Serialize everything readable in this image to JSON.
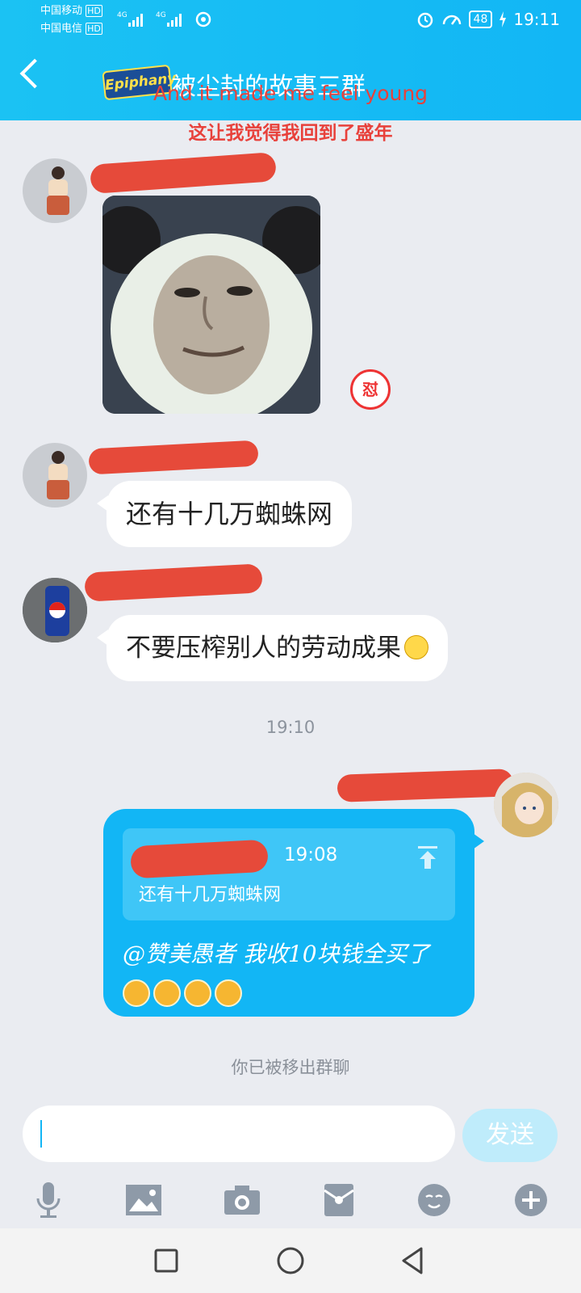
{
  "status_bar": {
    "carrier1": "中国移动",
    "carrier1_tag": "HD",
    "carrier2": "中国电信",
    "carrier2_tag": "HD",
    "net1": "4G",
    "net2": "4G",
    "battery": "48",
    "time": "19:11"
  },
  "header": {
    "title": "被尘封的故事三群",
    "logo_text": "Epiphany",
    "lyric_en": "And it made me feel young",
    "lyric_cn": "这让我觉得我回到了盛年"
  },
  "messages": [
    {
      "type": "sticker",
      "badge": "怼"
    },
    {
      "type": "text",
      "text": "还有十几万蜘蛛网"
    },
    {
      "type": "text",
      "text": "不要压榨别人的劳动成果"
    }
  ],
  "timestamp": "19:10",
  "my_message": {
    "quote_time": "19:08",
    "quote_text": "还有十几万蜘蛛网",
    "reply": "@赞美愚者 我收10块钱全买了"
  },
  "system_notice": "你已被移出群聊",
  "composer": {
    "send_label": "发送"
  },
  "colors": {
    "header": "#12b6f5",
    "background": "#eaecf1",
    "redaction": "#e64a3a"
  },
  "toolbar_icons": [
    "microphone-icon",
    "image-icon",
    "camera-icon",
    "red-packet-icon",
    "emoji-icon",
    "plus-icon"
  ],
  "nav_icons": [
    "recent-apps-icon",
    "home-icon",
    "back-icon"
  ]
}
